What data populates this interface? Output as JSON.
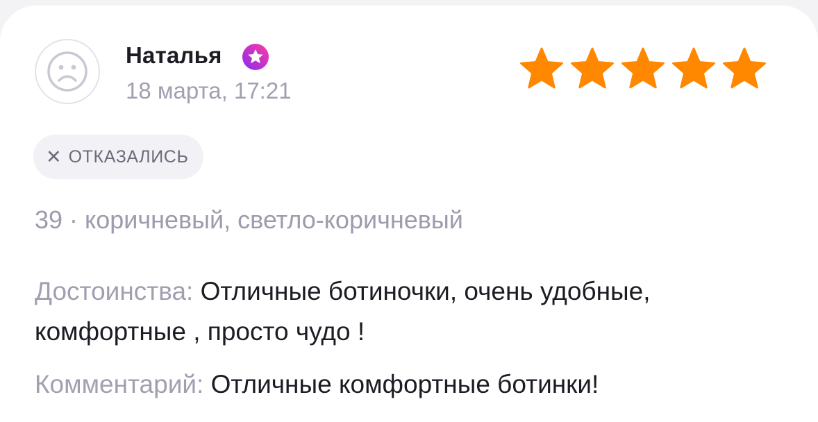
{
  "review": {
    "author": "Наталья",
    "date": "18 марта, 17:21",
    "rating": 5,
    "rating_max": 5,
    "status": "ОТКАЗАЛИСЬ",
    "status_icon": "close-icon",
    "variant": "39 · коричневый, светло-коричневый",
    "pros_label": "Достоинства:",
    "pros_text": " Отличные ботиночки, очень удобные, комфортные , просто чудо !",
    "comment_label": "Комментарий:",
    "comment_text": " Отличные комфортные ботинки!"
  },
  "colors": {
    "star": "#ff8800",
    "badge_gradient_start": "#8a2cf0",
    "badge_gradient_end": "#ff3aa4",
    "muted_text": "#a19fb0",
    "chip_bg": "#f2f1f5"
  },
  "icons": {
    "avatar": "sad-face-icon",
    "verified": "star-badge-icon",
    "rating": "star-icon"
  }
}
